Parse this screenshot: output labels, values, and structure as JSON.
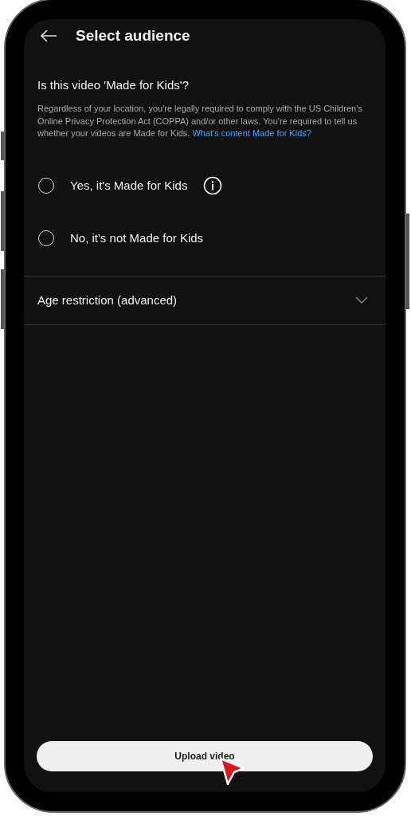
{
  "header": {
    "title": "Select audience"
  },
  "question": {
    "title": "Is this video 'Made for Kids'?",
    "body": "Regardless of your location, you're legally required to comply with the US Children's Online Privacy Protection Act (COPPA) and/or other laws. You're required to tell us whether your videos are Made for Kids.",
    "link": "What's content Made for Kids?"
  },
  "options": [
    {
      "label": "Yes, it's Made for Kids",
      "selected": false,
      "info_icon": true
    },
    {
      "label": "No, it's not Made for Kids",
      "selected": false,
      "info_icon": false
    }
  ],
  "age_restriction": {
    "label": "Age restriction (advanced)",
    "expanded": false
  },
  "primary_button": {
    "label": "Upload video"
  }
}
